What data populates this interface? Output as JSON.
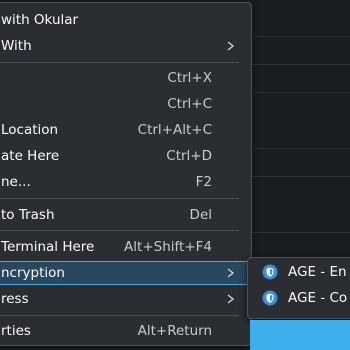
{
  "menu": {
    "items": [
      {
        "label": "with Okular",
        "shortcut": "",
        "submenu": false
      },
      {
        "label": "With",
        "shortcut": "",
        "submenu": true
      },
      {
        "label": "",
        "shortcut": "Ctrl+X",
        "submenu": false
      },
      {
        "label": "",
        "shortcut": "Ctrl+C",
        "submenu": false
      },
      {
        "label": "Location",
        "shortcut": "Ctrl+Alt+C",
        "submenu": false
      },
      {
        "label": "ate Here",
        "shortcut": "Ctrl+D",
        "submenu": false
      },
      {
        "label": "ne...",
        "shortcut": "F2",
        "submenu": false
      },
      {
        "label": "to Trash",
        "shortcut": "Del",
        "submenu": false
      },
      {
        "label": "Terminal Here",
        "shortcut": "Alt+Shift+F4",
        "submenu": false
      },
      {
        "label": "ncryption",
        "shortcut": "",
        "submenu": true,
        "active": true
      },
      {
        "label": "ress",
        "shortcut": "",
        "submenu": true
      },
      {
        "label": "rties",
        "shortcut": "Alt+Return",
        "submenu": false
      }
    ]
  },
  "submenu": {
    "items": [
      {
        "label": "AGE - En",
        "icon": "shield-icon"
      },
      {
        "label": "AGE - Co",
        "icon": "shield-icon"
      }
    ]
  },
  "colors": {
    "menu_bg": "#2a2e32",
    "highlight": "#29475e",
    "accent": "#3daee9",
    "text": "#fcfcfc"
  }
}
